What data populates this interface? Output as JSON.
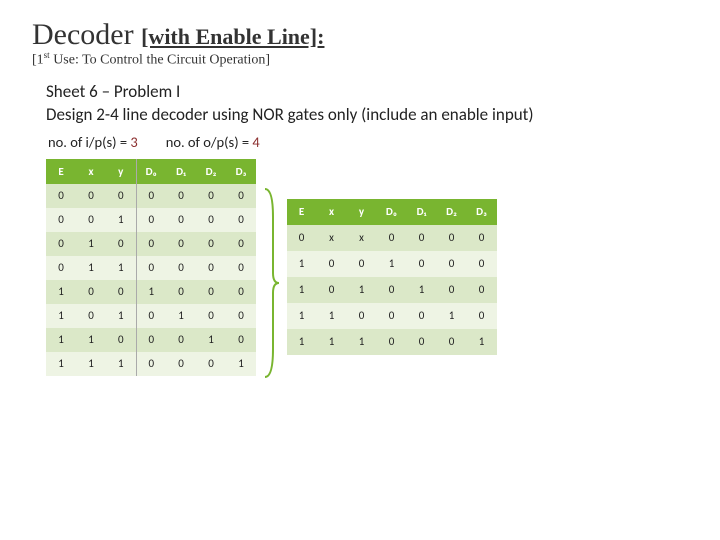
{
  "title_main": "Decoder ",
  "title_sub": "[with Enable Line]:",
  "subtitle_pre": "[1",
  "subtitle_sup": "st",
  "subtitle_post": " Use: To Control the Circuit Operation]",
  "sheet": "Sheet 6 – Problem I",
  "desc": "Design 2-4 line decoder using NOR gates only (include an enable input)",
  "io": {
    "ip_label": "no. of i/p(s) = ",
    "ip_val": "3",
    "op_label": "no. of o/p(s) = ",
    "op_val": "4"
  },
  "t1": {
    "headers": [
      "E",
      "x",
      "y",
      "D₀",
      "D₁",
      "D₂",
      "D₃"
    ],
    "rows": [
      [
        "0",
        "0",
        "0",
        "0",
        "0",
        "0",
        "0"
      ],
      [
        "0",
        "0",
        "1",
        "0",
        "0",
        "0",
        "0"
      ],
      [
        "0",
        "1",
        "0",
        "0",
        "0",
        "0",
        "0"
      ],
      [
        "0",
        "1",
        "1",
        "0",
        "0",
        "0",
        "0"
      ],
      [
        "1",
        "0",
        "0",
        "1",
        "0",
        "0",
        "0"
      ],
      [
        "1",
        "0",
        "1",
        "0",
        "1",
        "0",
        "0"
      ],
      [
        "1",
        "1",
        "0",
        "0",
        "0",
        "1",
        "0"
      ],
      [
        "1",
        "1",
        "1",
        "0",
        "0",
        "0",
        "1"
      ]
    ]
  },
  "t2": {
    "headers": [
      "E",
      "x",
      "y",
      "D₀",
      "D₁",
      "D₂",
      "D₃"
    ],
    "rows": [
      [
        "0",
        "x",
        "x",
        "0",
        "0",
        "0",
        "0"
      ],
      [
        "1",
        "0",
        "0",
        "1",
        "0",
        "0",
        "0"
      ],
      [
        "1",
        "0",
        "1",
        "0",
        "1",
        "0",
        "0"
      ],
      [
        "1",
        "1",
        "0",
        "0",
        "0",
        "1",
        "0"
      ],
      [
        "1",
        "1",
        "1",
        "0",
        "0",
        "0",
        "1"
      ]
    ]
  }
}
